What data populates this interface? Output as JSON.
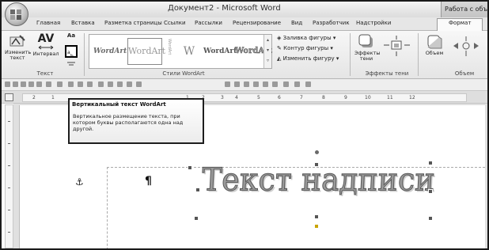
{
  "window": {
    "title": "Документ2 - Microsoft Word",
    "context_tab": "Работа с объектами"
  },
  "tabs": [
    {
      "label": "Главная"
    },
    {
      "label": "Вставка"
    },
    {
      "label": "Разметка страницы"
    },
    {
      "label": "Ссылки"
    },
    {
      "label": "Рассылки"
    },
    {
      "label": "Рецензирование"
    },
    {
      "label": "Вид"
    },
    {
      "label": "Разработчик"
    },
    {
      "label": "Надстройки"
    },
    {
      "label": "Формат"
    }
  ],
  "ribbon": {
    "text_group": {
      "label": "Текст",
      "edit_text": "Изменить текст",
      "spacing": "Интервал",
      "aa_icon": "Aa"
    },
    "styles_group": {
      "label": "Стили WordArt",
      "gallery": [
        "WordArt",
        "WordArt",
        "WordArt",
        "W",
        "WordArt",
        "WordArt"
      ]
    },
    "shape_cmds": {
      "fill": "Заливка фигуры",
      "outline": "Контур фигуры",
      "change": "Изменить фигуру"
    },
    "shadow_group": {
      "label": "Эффекты тени",
      "button": "Эффекты тени"
    },
    "volume_group": {
      "label": "Объем",
      "button": "Объем"
    }
  },
  "ruler": {
    "numbers": [
      "2",
      "1",
      "1",
      "2",
      "3",
      "4",
      "5",
      "6",
      "7",
      "8",
      "9",
      "10",
      "11",
      "12"
    ]
  },
  "document": {
    "wordart_text": "Текст надписи",
    "pilcrow": "¶",
    "anchor": "⚓"
  },
  "tooltip": {
    "title": "Вертикальный текст WordArt",
    "body": "Вертикальное размещение текста, при котором буквы располагаются одна над другой."
  }
}
